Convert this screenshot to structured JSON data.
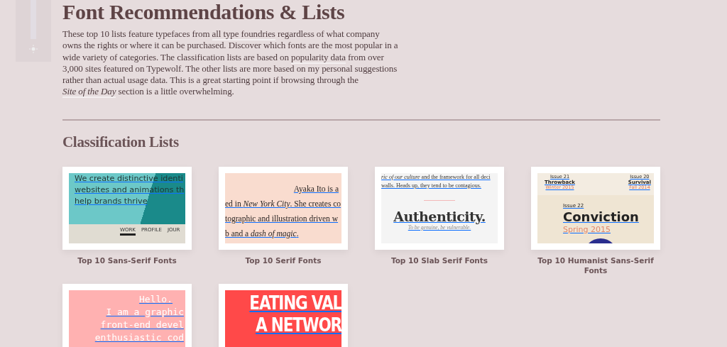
{
  "page": {
    "title": "Font Recommendations & Lists",
    "intro": [
      {
        "text": "These top 10 lists feature typefaces from ",
        "link": false,
        "italic": false
      },
      {
        "text": "all type foundries",
        "link": true,
        "italic": false
      },
      {
        "text": " regardless of what company owns the rights or where it can be purchased. Discover which fonts are the most popular in a wide variety of categories. The classification lists are based on ",
        "link": false,
        "italic": false
      },
      {
        "text": "popularity data",
        "link": true,
        "italic": false
      },
      {
        "text": " from over 3,000 sites featured on Typewolf. The other lists are more based on my personal suggestions rather than actual usage data. This is a great starting point if browsing through the ",
        "link": false,
        "italic": false
      },
      {
        "text": "Site of the Day",
        "link": true,
        "italic": true
      },
      {
        "text": " section is a little overwhelming.",
        "link": false,
        "italic": false
      }
    ]
  },
  "section": {
    "title": "Classification Lists",
    "cards": [
      {
        "title": "Top 10 Sans-Serif Fonts",
        "preview": {
          "kind": "sans",
          "lines": [
            "We create distinctive identi",
            "websites and animations th",
            "help brands thrive"
          ],
          "nav": [
            {
              "text": "WORK",
              "selected": true
            },
            {
              "text": "PROFILE",
              "selected": false
            },
            {
              "text": "JOUR",
              "selected": false
            }
          ]
        }
      },
      {
        "title": "Top 10 Serif Fonts",
        "preview": {
          "kind": "serif",
          "lines": [
            "Ayaka Ito is a",
            "ed in *New York City*. She creates co",
            "tographic and illustration driven w",
            "b and a *dash of magic*."
          ]
        }
      },
      {
        "title": "Top 10 Slab Serif Fonts",
        "preview": {
          "kind": "slab",
          "lines": [
            "*ric of our culture* and the framework for all deci",
            "walls. Heads up, they tend to be contagious.",
            "Authenticity.",
            "To be genuine, be vulnerable."
          ]
        }
      },
      {
        "title": "Top 10 Humanist Sans-Serif Fonts",
        "preview": {
          "kind": "humanist",
          "issues": [
            {
              "number": "Issue 21",
              "name": "Throwback",
              "date": "Winter 2015"
            },
            {
              "number": "Issue 20",
              "name": "Survival",
              "date": "Fall 2014"
            }
          ],
          "lines": [
            "Issue 22",
            "Conviction",
            "Spring 2015"
          ]
        }
      },
      {
        "preview": {
          "kind": "mono",
          "lines": [
            "Hello.",
            "I am a graphic",
            "front-end devel",
            "enthusiastic cod"
          ]
        }
      },
      {
        "preview": {
          "kind": "poster",
          "lines": [
            "EATING VAL",
            "A NETWOR"
          ]
        }
      }
    ]
  }
}
